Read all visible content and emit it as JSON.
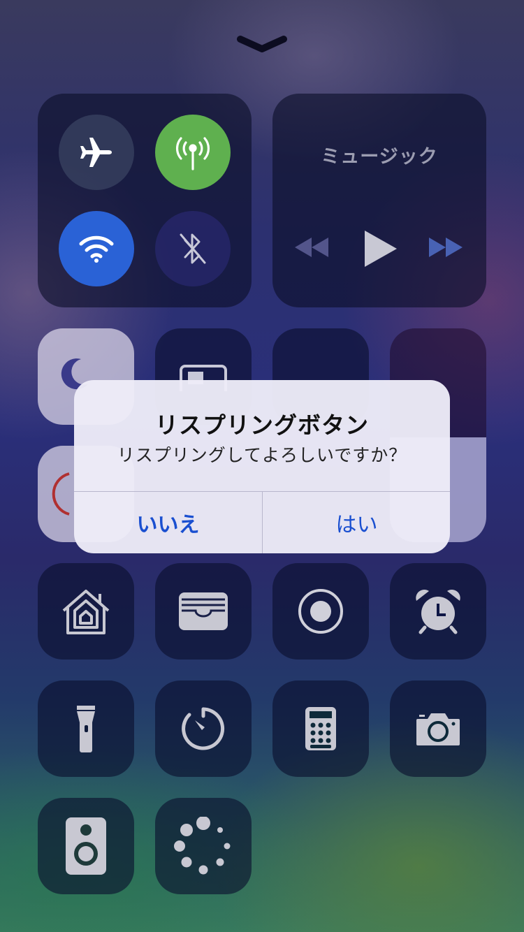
{
  "music": {
    "title": "ミュージック"
  },
  "alert": {
    "title": "リスプリングボタン",
    "message": "リスプリングしてよろしいですか？",
    "cancel_label": "いいえ",
    "confirm_label": "はい"
  },
  "icons": {
    "connectivity": [
      "airplane-icon",
      "cellular-icon",
      "wifi-icon",
      "bluetooth-off-icon"
    ],
    "media": [
      "rewind-icon",
      "play-icon",
      "fast-forward-icon"
    ],
    "row_tiles": [
      "do-not-disturb-icon",
      "screen-mirroring-icon",
      "brightness-slider",
      "volume-slider"
    ],
    "shortcuts": [
      "home-icon",
      "wallet-icon",
      "screen-record-icon",
      "alarm-icon",
      "flashlight-icon",
      "timer-icon",
      "calculator-icon",
      "camera-icon",
      "speaker-icon",
      "respring-loading-icon"
    ]
  },
  "colors": {
    "cellular_active": "#5fb04f",
    "wifi_active": "#2a62d6",
    "alert_button": "#1a4fd0"
  }
}
